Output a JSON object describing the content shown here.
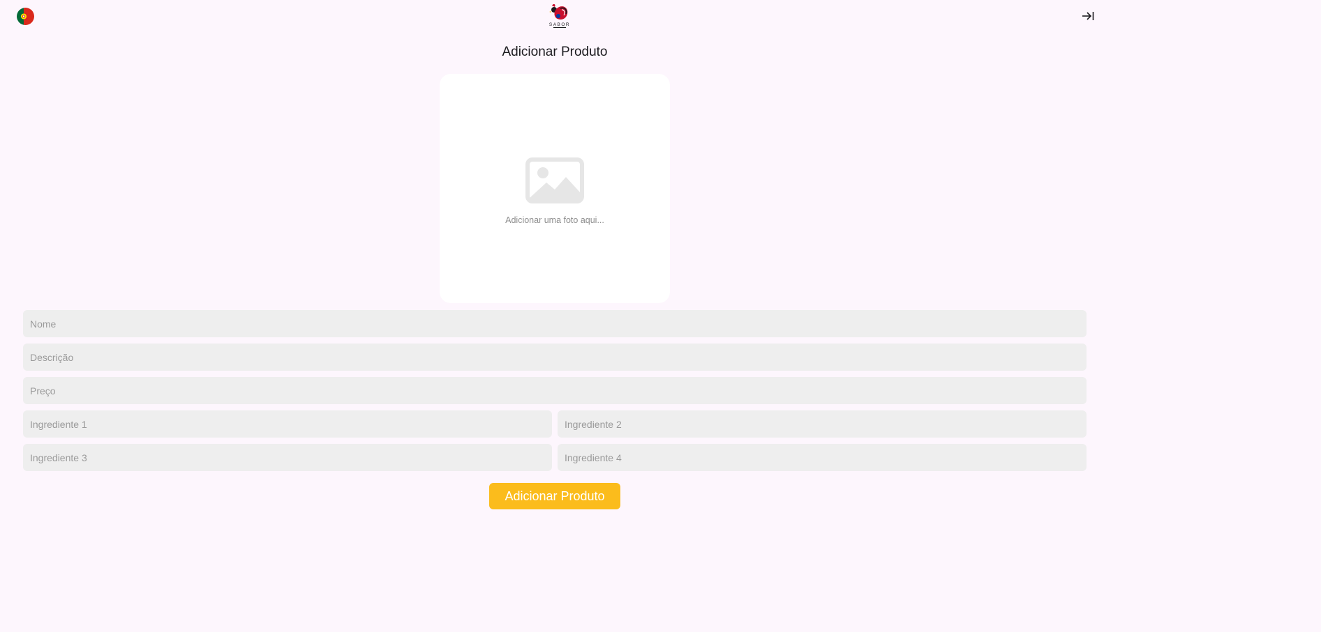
{
  "header": {
    "language_flag_icon": "portugal-flag-icon",
    "logo_text": "SABOR",
    "logout_icon": "logout-arrow-icon"
  },
  "page": {
    "title": "Adicionar Produto"
  },
  "photo": {
    "icon": "image-placeholder-icon",
    "hint": "Adicionar uma foto aqui..."
  },
  "form": {
    "name_placeholder": "Nome",
    "description_placeholder": "Descrição",
    "price_placeholder": "Preço",
    "ingredient1_placeholder": "Ingrediente 1",
    "ingredient2_placeholder": "Ingrediente 2",
    "ingredient3_placeholder": "Ingrediente 3",
    "ingredient4_placeholder": "Ingrediente 4",
    "submit_label": "Adicionar Produto"
  },
  "colors": {
    "background": "#fdf6fd",
    "input_fill": "#eeeeee",
    "accent": "#fbbc1c"
  }
}
